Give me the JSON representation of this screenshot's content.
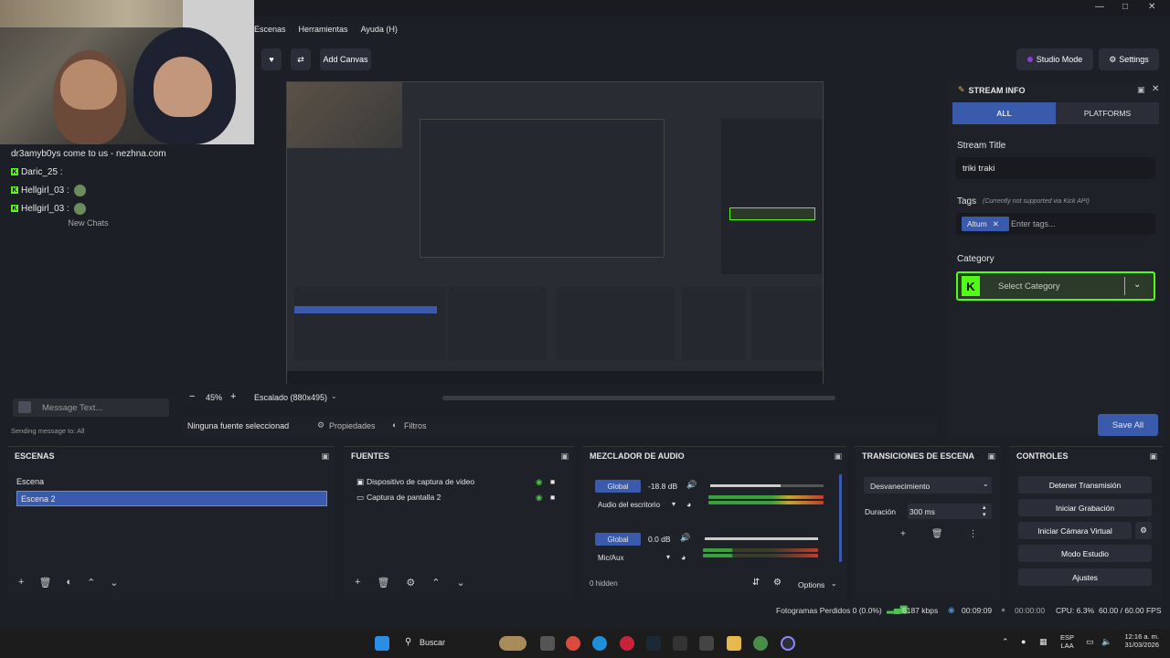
{
  "menu": {
    "items": [
      "Escenas",
      "Herramientas",
      "Ayuda (H)"
    ]
  },
  "toolbar": {
    "add_canvas": "Add Canvas",
    "studio_mode": "Studio Mode",
    "settings": "Settings"
  },
  "chat": {
    "lines": [
      {
        "text": "dr3amyb0ys come to us - nezhna.com",
        "badge": false
      },
      {
        "user": "Daric_25 :",
        "badge": true
      },
      {
        "user": "Hellgirl_03 :",
        "badge": true
      },
      {
        "user": "Hellgirl_03 :",
        "badge": true
      }
    ],
    "new_chats": "New Chats",
    "message_placeholder": "Message Text...",
    "sending_to": "Sending message to: All"
  },
  "preview": {
    "zoom_value": "45%",
    "scaling": "Escalado (880x495)",
    "no_source": "Ninguna fuente seleccionad",
    "properties": "Propiedades",
    "filters": "Filtros"
  },
  "stream_info": {
    "title": "STREAM INFO",
    "tab_all": "ALL",
    "tab_platforms": "PLATFORMS",
    "stream_title_label": "Stream Title",
    "stream_title_value": "triki traki",
    "tags_label": "Tags",
    "tags_note": "(Currently not supported via Kick API)",
    "tag_chip": "Altum",
    "tags_placeholder": "Enter tags...",
    "category_label": "Category",
    "category_placeholder": "Select Category",
    "save_all": "Save All"
  },
  "scenes": {
    "title": "ESCENAS",
    "items": [
      "Escena",
      "Escena 2"
    ]
  },
  "sources": {
    "title": "FUENTES",
    "items": [
      "Dispositivo de captura de video",
      "Captura de pantalla 2"
    ]
  },
  "mixer": {
    "title": "MEZCLADOR DE AUDIO",
    "channels": [
      {
        "badge": "Global",
        "db": "-18.8 dB",
        "device": "Audio del escritorio",
        "level": 0.62
      },
      {
        "badge": "Global",
        "db": "0.0 dB",
        "device": "Mic/Aux",
        "level": 1.0
      }
    ],
    "hidden": "0 hidden",
    "options": "Options"
  },
  "transitions": {
    "title": "TRANSICIONES DE ESCENA",
    "selected": "Desvanecimiento",
    "duration_label": "Duración",
    "duration_value": "300 ms"
  },
  "controls": {
    "title": "CONTROLES",
    "buttons": [
      "Detener Transmisión",
      "Iniciar Grabación",
      "Iniciar Cámara Virtual",
      "Modo Estudio",
      "Ajustes"
    ]
  },
  "status": {
    "dropped": "Fotogramas Perdidos 0 (0.0%)",
    "bitrate": "6187 kbps",
    "live_time": "00:09:09",
    "rec_time": "00:00:00",
    "cpu": "CPU: 6.3%",
    "fps": "60.00 / 60.00 FPS"
  },
  "taskbar": {
    "search": "Buscar",
    "lang_1": "ESP",
    "lang_2": "LAA",
    "time": "12:16 a. m.",
    "date": "31/03/2026"
  },
  "colors": {
    "accent_blue": "#3a5aac",
    "kick_green": "#53fc18"
  }
}
